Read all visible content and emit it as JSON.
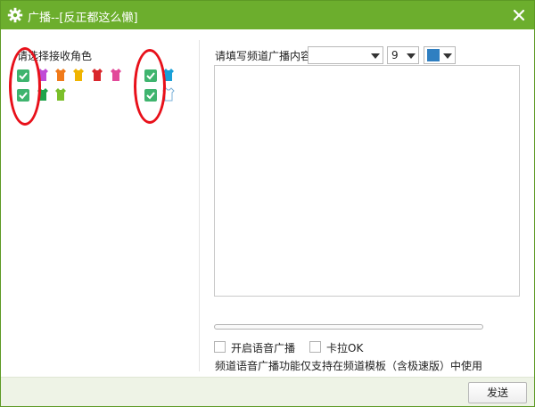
{
  "window": {
    "title": "广播--[反正都这么懒]",
    "icon": "gear-icon",
    "accent_color": "#6cae2d"
  },
  "left": {
    "label": "请选择接收角色",
    "group_a": {
      "row1": {
        "checked": true,
        "icons": [
          "#c04bd6",
          "#f07a1a",
          "#f0b400",
          "#d9262c",
          "#e24a9a"
        ]
      },
      "row2": {
        "checked": true,
        "icons": [
          "#1fa34a",
          "#7bbf2a"
        ]
      }
    },
    "group_b": {
      "row1": {
        "checked": true,
        "icons": [
          "#1aa0d8"
        ]
      },
      "row2": {
        "checked": true,
        "icons": [
          "#ffffff"
        ]
      }
    },
    "highlight_color": "#e8101a"
  },
  "right": {
    "content_label": "请填写频道广播内容",
    "font_dropdown": {
      "value": ""
    },
    "size_dropdown": {
      "value": "9"
    },
    "color_dropdown": {
      "value": "#2f7fc1"
    },
    "message_text": "",
    "progress": 0,
    "voice_option": {
      "label": "开启语音广播",
      "checked": false
    },
    "karaoke_option": {
      "label": "卡拉OK",
      "checked": false
    },
    "note": "频道语音广播功能仅支持在频道模板（含极速版）中使用"
  },
  "footer": {
    "send_label": "发送"
  }
}
